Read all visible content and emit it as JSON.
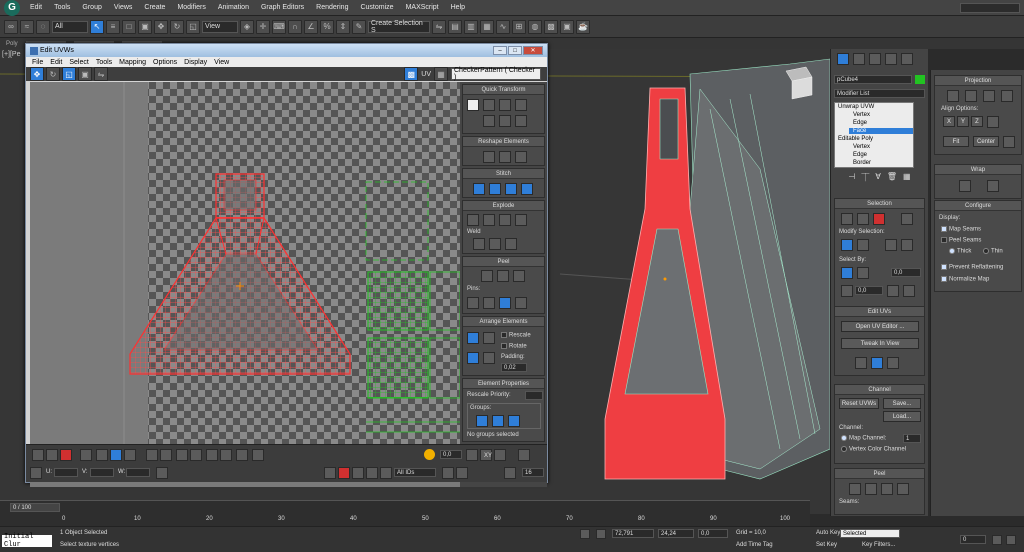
{
  "menubar": {
    "logo": "G",
    "items": [
      "Edit",
      "Tools",
      "Group",
      "Views",
      "Create",
      "Modifiers",
      "Animation",
      "Graph Editors",
      "Rendering",
      "Customize",
      "MAXScript",
      "Help"
    ]
  },
  "toolbar": {
    "filter": "All",
    "view": "View",
    "selection_set": "Create Selection S"
  },
  "ribbon": {
    "label": "Poly"
  },
  "viewport": {
    "label": "[+][Pe"
  },
  "uv_editor": {
    "title": "Edit UVWs",
    "menu": [
      "File",
      "Edit",
      "Select",
      "Tools",
      "Mapping",
      "Options",
      "Display",
      "View"
    ],
    "uv_label": "UV",
    "texture": "CheckerPattern  ( Checker )",
    "rollouts": {
      "quick_transform": "Quick Transform",
      "reshape": "Reshape Elements",
      "stitch": "Stitch",
      "explode": "Explode",
      "weld": "Weld",
      "peel": "Peel",
      "pins": "Pins:",
      "arrange": "Arrange Elements",
      "rescale": "Rescale",
      "rotate": "Rotate",
      "padding": "Padding:",
      "padding_value": "0,02",
      "element_props": "Element Properties",
      "rescale_priority": "Rescale Priority:",
      "groups": "Groups:",
      "no_groups": "No groups selected"
    },
    "bottom": {
      "value_left": "0,0",
      "u_label": "U:",
      "v_label": "V:",
      "w_label": "W:",
      "xy_label": "XY",
      "ids": "All IDs",
      "value_right": "16"
    }
  },
  "cmd_panel": {
    "object_name": "pCube4",
    "modifier_list": "Modifier List",
    "stack": [
      "Unwrap UVW",
      "Vertex",
      "Edge",
      "Face",
      "Editable Poly",
      "Vertex",
      "Edge",
      "Border"
    ],
    "selection_header": "Selection",
    "modify_selection": "Modify Selection:",
    "select_by": "Select By:",
    "select_value": "0,0",
    "select_value2": "0,0",
    "edit_uvs": "Edit UVs",
    "open_uv_editor": "Open UV Editor ...",
    "tweak": "Tweak In View",
    "channel_header": "Channel",
    "reset_uvws": "Reset UVWs",
    "save": "Save...",
    "load": "Load...",
    "channel_label": "Channel:",
    "map_channel": "Map Channel:",
    "map_channel_value": "1",
    "vertex_color_channel": "Vertex Color Channel",
    "peel_header": "Peel",
    "seams": "Seams:"
  },
  "right_panel": {
    "projection": "Projection",
    "align_options": "Align Options:",
    "axes": [
      "X",
      "Y",
      "Z"
    ],
    "fit": "Fit",
    "center": "Center",
    "wrap": "Wrap",
    "configure": "Configure",
    "display": "Display:",
    "map_seams": "Map Seams",
    "peel_seams": "Peel Seams",
    "thick": "Thick",
    "thin": "Thin",
    "prevent_reflattening": "Prevent Reflattening",
    "normalize_map": "Normalize Map"
  },
  "timeline": {
    "frame": "0 / 100",
    "ticks": [
      "0",
      "10",
      "20",
      "30",
      "40",
      "50",
      "60",
      "70",
      "80",
      "90",
      "100"
    ]
  },
  "status": {
    "script": "Initial Clur",
    "selected": "1 Object Selected",
    "prompt": "Select texture vertices",
    "x": "72,791",
    "y": "24,24",
    "z": "0,0",
    "grid": "Grid = 10,0",
    "add_time_tag": "Add Time Tag",
    "auto_key": "Auto Key",
    "set_key": "Set Key",
    "selected_dd": "Selected",
    "key_filters": "Key Filters...",
    "frame": "0"
  },
  "colors": {
    "seam_red": "#e63b3b",
    "uv_green": "#22c322",
    "accent_blue": "#2f7ed8"
  }
}
